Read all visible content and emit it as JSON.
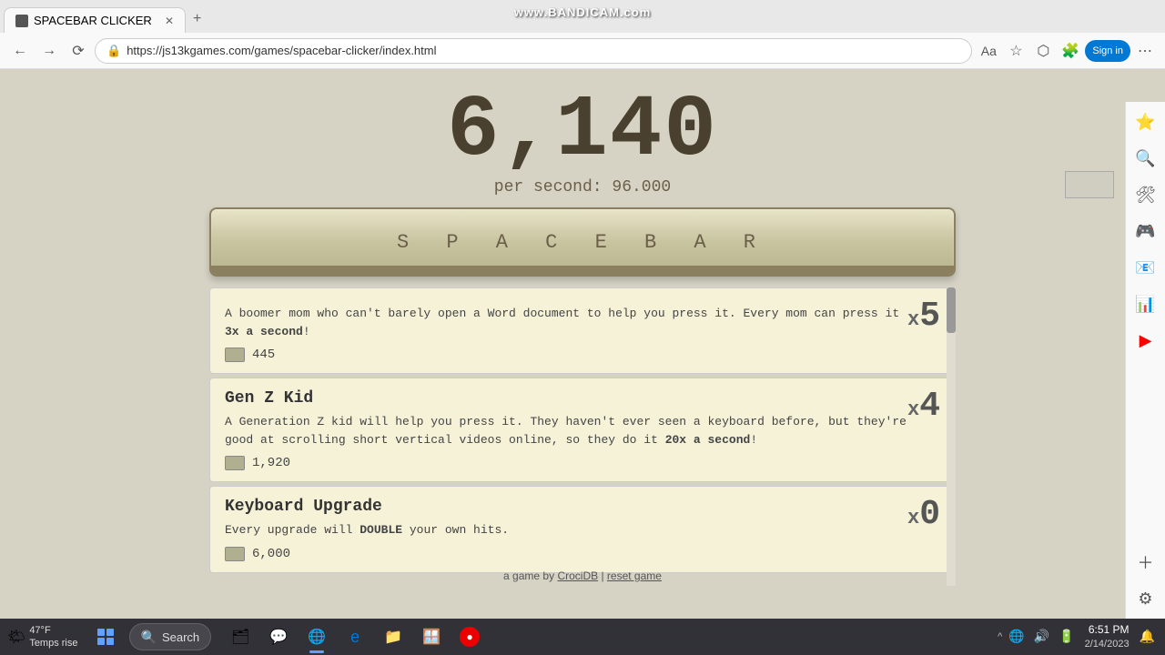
{
  "browser": {
    "tab_title": "SPACEBAR CLICKER",
    "url": "https://js13kgames.com/games/spacebar-clicker/index.html",
    "new_tab_tooltip": "New tab"
  },
  "bandicam": {
    "watermark": "www.BANDICAM.com"
  },
  "game": {
    "score": "6,140",
    "per_second_label": "per second:",
    "per_second_value": "96.000",
    "spacebar_label": "S P A C E B A R",
    "upgrades": [
      {
        "id": "boomer-mom",
        "title": "",
        "desc_prefix": "A boomer mom who can't barely open a Word document to help you press it. Every mom can press it ",
        "desc_bold": "3x a second",
        "desc_suffix": "!",
        "cost": "445",
        "multiplier": "5",
        "multiplier_prefix": "x"
      },
      {
        "id": "gen-z-kid",
        "title": "Gen Z Kid",
        "desc_prefix": "A Generation Z kid will help you press it. They haven't ever seen a keyboard before, but they're good at scrolling short vertical videos online, so they do it ",
        "desc_bold": "20x a second",
        "desc_suffix": "!",
        "cost": "1,920",
        "multiplier": "4",
        "multiplier_prefix": "x"
      },
      {
        "id": "keyboard-upgrade",
        "title": "Keyboard Upgrade",
        "desc_prefix": "Every upgrade will ",
        "desc_bold": "DOUBLE",
        "desc_suffix": " your own hits.",
        "cost": "6,000",
        "multiplier": "0",
        "multiplier_prefix": "x"
      }
    ]
  },
  "footer": {
    "text": "a game by",
    "link1": "CrociDB",
    "separator": "|",
    "link2": "reset game"
  },
  "taskbar": {
    "search_placeholder": "Search",
    "time": "6:51 PM",
    "date": "2/14/2023",
    "weather_temp": "47°F",
    "weather_desc": "Temps rise",
    "apps": [
      {
        "name": "file-explorer",
        "icon": "🗂"
      },
      {
        "name": "messenger",
        "icon": "💬"
      },
      {
        "name": "chrome",
        "icon": "🌐"
      },
      {
        "name": "edge",
        "icon": "🌀"
      },
      {
        "name": "folder",
        "icon": "📁"
      },
      {
        "name": "windows-store",
        "icon": "🪟"
      },
      {
        "name": "media-player",
        "icon": "🎵"
      }
    ]
  }
}
